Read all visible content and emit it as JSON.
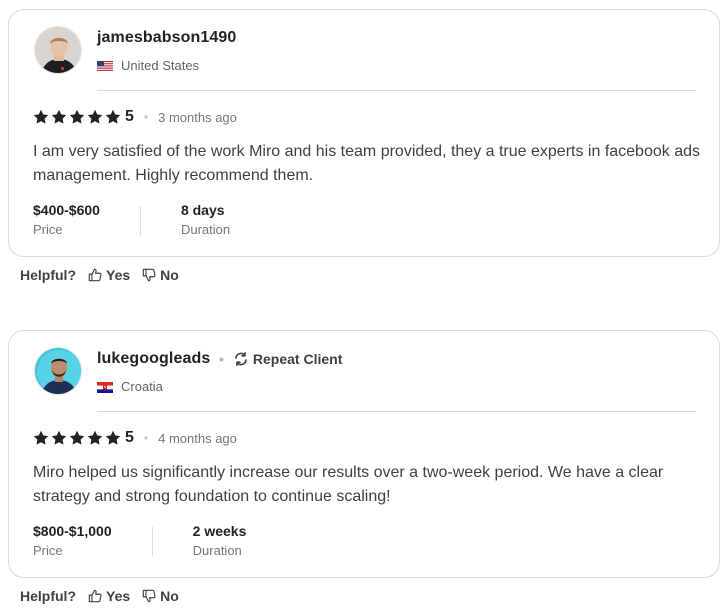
{
  "reviews": [
    {
      "username": "jamesbabson1490",
      "repeat_client": null,
      "country": "United States",
      "rating_value": "5",
      "time_ago": "3 months ago",
      "text": "I am very satisfied of the work Miro and his team provided, they a true experts in facebook ads management. Highly recommend them.",
      "price_value": "$400-$600",
      "price_label": "Price",
      "duration_value": "8 days",
      "duration_label": "Duration",
      "helpful_label": "Helpful?",
      "yes_label": "Yes",
      "no_label": "No"
    },
    {
      "username": "lukegoogleads",
      "repeat_client": "Repeat Client",
      "country": "Croatia",
      "rating_value": "5",
      "time_ago": "4 months ago",
      "text": "Miro helped us significantly increase our results over a two-week period. We have a clear strategy and strong foundation to continue scaling!",
      "price_value": "$800-$1,000",
      "price_label": "Price",
      "duration_value": "2 weeks",
      "duration_label": "Duration",
      "helpful_label": "Helpful?",
      "yes_label": "Yes",
      "no_label": "No"
    }
  ],
  "colors": {
    "star": "#222325",
    "border": "#dadbdd",
    "text": "#404145"
  },
  "icons": {
    "star": "star-icon",
    "thumb_up": "thumbs-up-icon",
    "thumb_down": "thumbs-down-icon",
    "repeat": "repeat-icon",
    "flag_us": "us-flag-icon",
    "flag_hr": "croatia-flag-icon"
  }
}
